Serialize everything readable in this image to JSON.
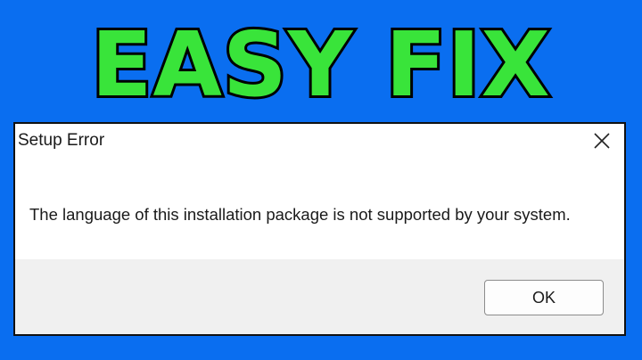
{
  "headline": "EASY FIX",
  "dialog": {
    "title": "Setup Error",
    "message": "The language of this installation package is not supported by your system.",
    "ok_label": "OK",
    "close_icon": "close-icon"
  },
  "colors": {
    "background": "#0a6ef0",
    "headline_fill": "#39e43a",
    "headline_outline": "#000000",
    "dialog_bg": "#ffffff",
    "footer_bg": "#f0f0f0"
  }
}
